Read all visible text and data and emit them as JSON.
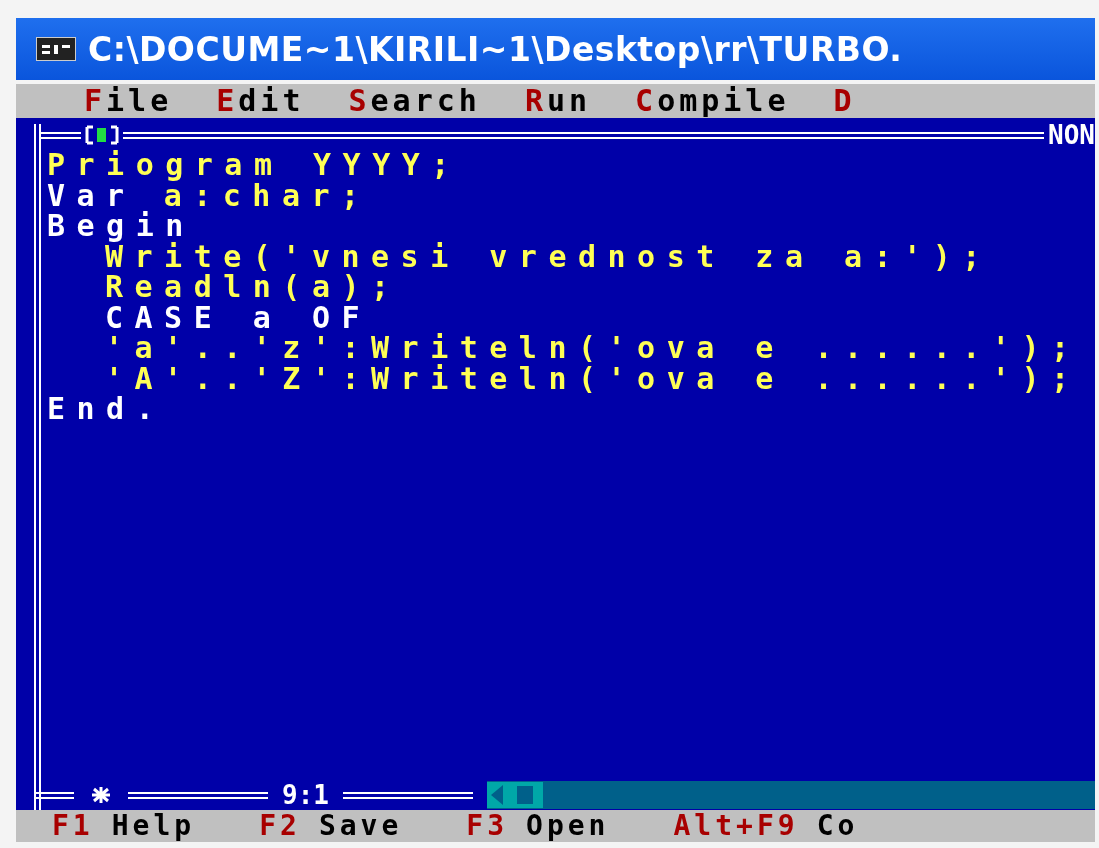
{
  "window": {
    "title": "C:\\DOCUME~1\\KIRILI~1\\Desktop\\rr\\TURBO."
  },
  "menu": [
    {
      "hotkey": "F",
      "rest": "ile"
    },
    {
      "hotkey": "E",
      "rest": "dit"
    },
    {
      "hotkey": "S",
      "rest": "earch"
    },
    {
      "hotkey": "R",
      "rest": "un"
    },
    {
      "hotkey": "C",
      "rest": "ompile"
    },
    {
      "hotkey": "D"
    }
  ],
  "editor": {
    "frame_label": "NON",
    "position": "9:1",
    "lines": [
      {
        "segments": [
          {
            "kind": "text",
            "text": "Priogram YYYY;"
          }
        ]
      },
      {
        "segments": [
          {
            "kind": "keyword",
            "text": "Var"
          },
          {
            "kind": "text",
            "text": "a:char;"
          }
        ]
      },
      {
        "segments": [
          {
            "kind": "keyword",
            "text": "Begin"
          }
        ],
        "children": [
          {
            "segments": [
              {
                "kind": "text",
                "text": "Write('vnesi vrednost za a:');"
              }
            ]
          },
          {
            "segments": [
              {
                "kind": "text",
                "text": "Readln(a);"
              }
            ]
          },
          {
            "segments": [
              {
                "kind": "keyword",
                "text": "CASE a OF"
              }
            ]
          },
          {
            "segments": [
              {
                "kind": "text",
                "text": "'a'..'z':Writeln('ova e ......');"
              }
            ]
          },
          {
            "segments": [
              {
                "kind": "text",
                "text": "'A'..'Z':Writeln('ova e ......');"
              }
            ]
          }
        ]
      },
      {
        "segments": [
          {
            "kind": "keyword",
            "text": "End."
          }
        ]
      }
    ]
  },
  "status_bar": [
    {
      "key": "F1",
      "label": "Help"
    },
    {
      "key": "F2",
      "label": "Save"
    },
    {
      "key": "F3",
      "label": "Open"
    },
    {
      "key": "Alt+F9",
      "label": "Co"
    }
  ]
}
